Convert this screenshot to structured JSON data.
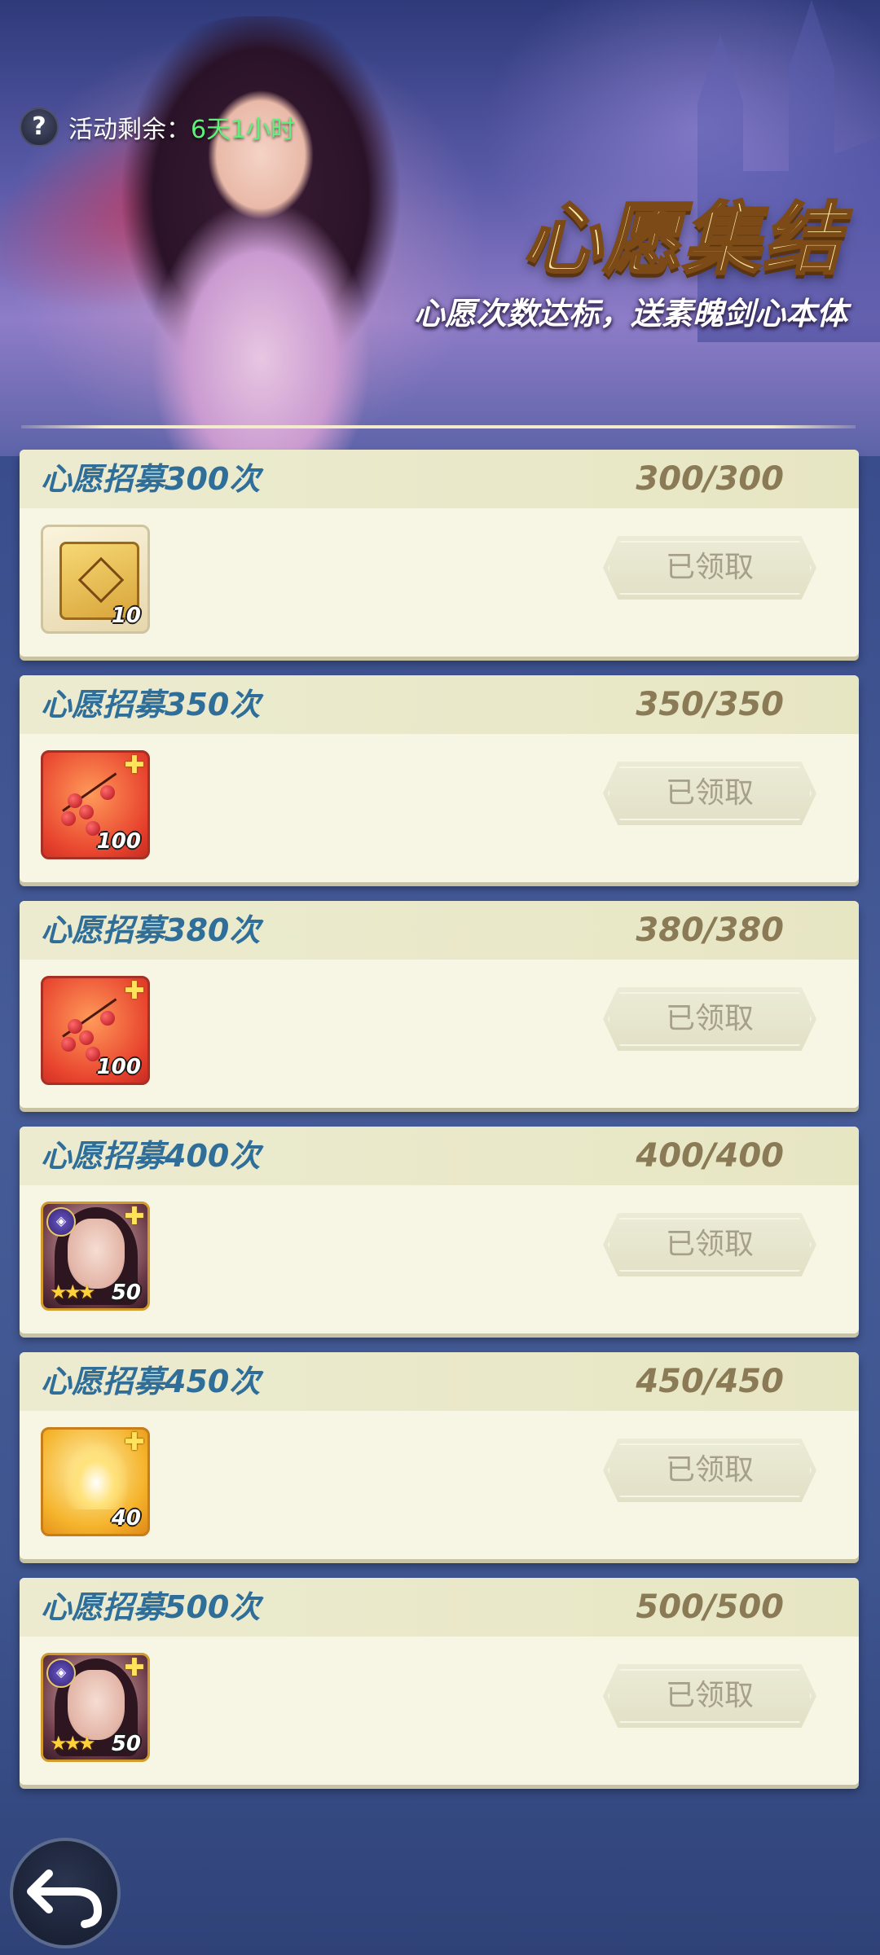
{
  "header": {
    "timer_label": "活动剩余：",
    "timer_value": "6天1小时",
    "title": "心愿集结",
    "subtitle": "心愿次数达标，送素魄剑心本体"
  },
  "tasks": [
    {
      "title": "心愿招募300次",
      "progress": "300/300",
      "reward_icon": "scroll-icon",
      "reward_count": "10",
      "button_label": "已领取"
    },
    {
      "title": "心愿招募350次",
      "progress": "350/350",
      "reward_icon": "red-berries-fragment-icon",
      "reward_count": "100",
      "button_label": "已领取"
    },
    {
      "title": "心愿招募380次",
      "progress": "380/380",
      "reward_icon": "red-berries-fragment-icon",
      "reward_count": "100",
      "button_label": "已领取"
    },
    {
      "title": "心愿招募400次",
      "progress": "400/400",
      "reward_icon": "hero-portrait-fragment-icon",
      "reward_count": "50",
      "button_label": "已领取"
    },
    {
      "title": "心愿招募450次",
      "progress": "450/450",
      "reward_icon": "golden-flame-fragment-icon",
      "reward_count": "40",
      "button_label": "已领取"
    },
    {
      "title": "心愿招募500次",
      "progress": "500/500",
      "reward_icon": "hero-portrait-fragment-icon",
      "reward_count": "50",
      "button_label": "已领取"
    }
  ],
  "colors": {
    "timer_value": "#5ef07a",
    "title_gold": "#fbe9a4",
    "task_title": "#2f6e98",
    "claimed_text": "#a6a08a"
  }
}
